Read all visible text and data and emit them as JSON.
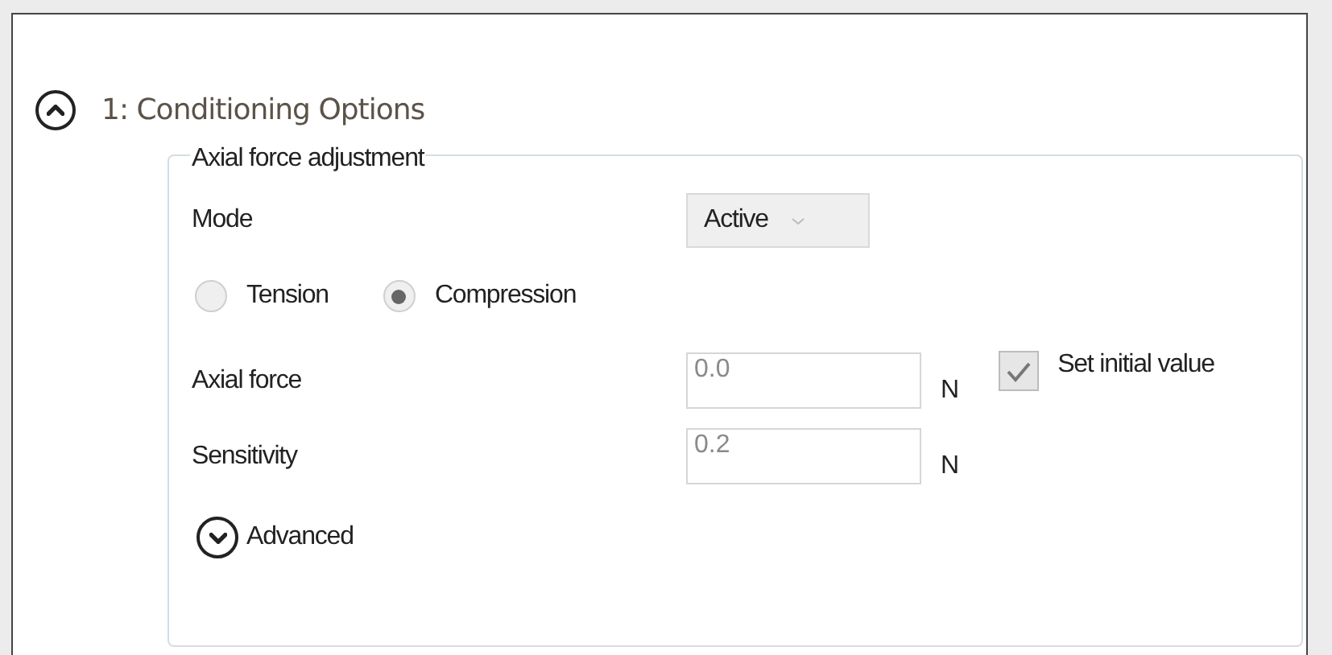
{
  "section": {
    "title": "1: Conditioning Options",
    "expanded": true
  },
  "group": {
    "legend": "Axial force adjustment"
  },
  "mode": {
    "label": "Mode",
    "value": "Active",
    "disabled": true
  },
  "direction": [
    {
      "label": "Tension",
      "selected": false
    },
    {
      "label": "Compression",
      "selected": true
    }
  ],
  "fields": [
    {
      "label": "Axial force",
      "value": "0.0",
      "unit": "N"
    },
    {
      "label": "Sensitivity",
      "value": "0.2",
      "unit": "N"
    }
  ],
  "set_initial_value": {
    "label": "Set initial value",
    "checked": true,
    "disabled": true
  },
  "advanced": {
    "label": "Advanced",
    "expanded": false
  }
}
